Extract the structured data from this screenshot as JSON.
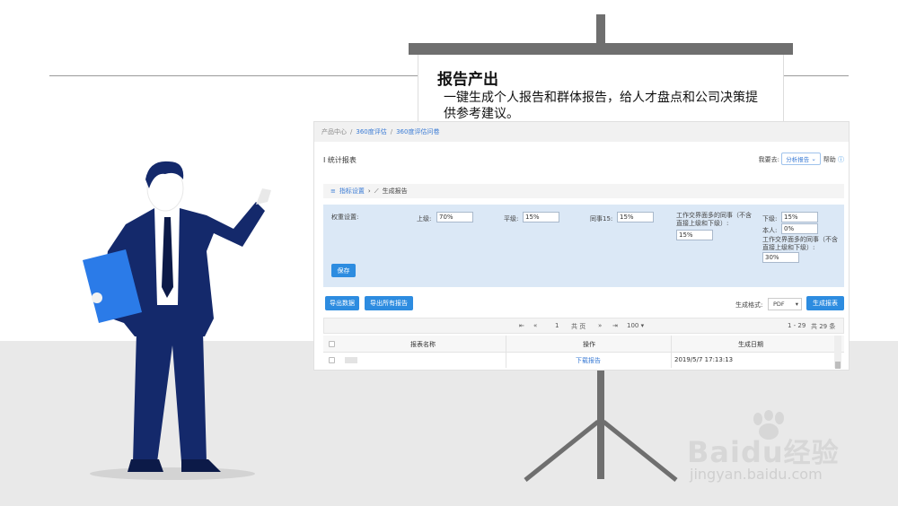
{
  "slide": {
    "title": "报告产出",
    "description": "一键生成个人报告和群体报告，给人才盘点和公司决策提供参考建议。"
  },
  "breadcrumb": [
    "产品中心",
    "360度评估",
    "360度评估问卷"
  ],
  "panel": {
    "title": "统计报表",
    "select_label": "我要去:",
    "select_value": "分析报告",
    "help_label": "帮助"
  },
  "tabs": {
    "indicator": "指标设置",
    "generate": "生成报告"
  },
  "weights": {
    "label": "权重设置:",
    "superior_label": "上级:",
    "superior_value": "70%",
    "peer_label": "平级:",
    "peer_value": "15%",
    "colleague15_label": "同事15:",
    "colleague15_value": "15%",
    "cross_label": "工作交界面多的同事（不含直接上级和下级）:",
    "cross_value": "15%",
    "subordinate_label": "下级:",
    "subordinate_value": "15%",
    "self_label": "本人:",
    "self_value": "0%",
    "cross2_label": "工作交界面多的同事（不含直接上级和下级）:",
    "cross2_value": "30%",
    "save": "保存"
  },
  "toolbar": {
    "export_data": "导出数据",
    "export_all": "导出所有报告",
    "format_label": "生成格式:",
    "format_value": "PDF",
    "generate": "生成报表"
  },
  "pager": {
    "page": "1",
    "total_pages": "共 页",
    "page_size": "100",
    "range": "1 - 29",
    "total": "共 29 条"
  },
  "table": {
    "headers": [
      "报表名称",
      "操作",
      "生成日期"
    ],
    "rows": [
      {
        "name": "",
        "action": "下载报告",
        "date": "2019/5/7 17:13:13"
      }
    ]
  },
  "watermark": {
    "brand": "Baidu",
    "brand_cn": "经验",
    "url": "jingyan.baidu.com"
  },
  "colors": {
    "accent": "#2d8ce0",
    "figure_suit": "#14296b",
    "folder": "#2b7be8",
    "panel_bg": "#dbe8f6"
  }
}
